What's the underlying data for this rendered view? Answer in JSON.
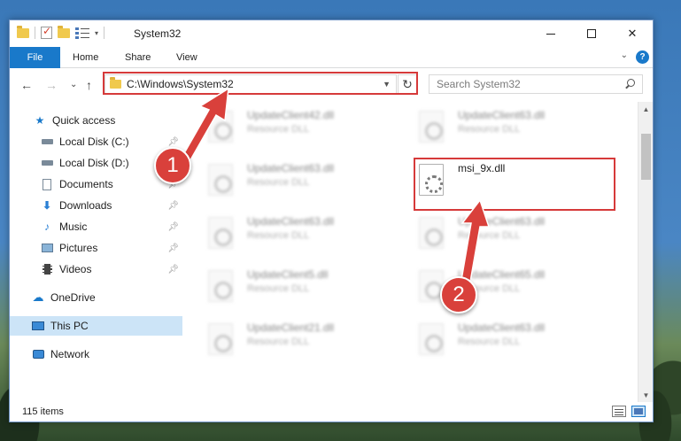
{
  "window": {
    "title": "System32",
    "controls": {
      "minimize": "",
      "maximize": "",
      "close": "✕"
    }
  },
  "ribbon": {
    "tabs": [
      {
        "label": "File"
      },
      {
        "label": "Home"
      },
      {
        "label": "Share"
      },
      {
        "label": "View"
      }
    ],
    "help": "?"
  },
  "navigation": {
    "back": "←",
    "forward": "→",
    "recent": "⌄",
    "up": "↑",
    "address": "C:\\Windows\\System32",
    "refresh": "↻"
  },
  "search": {
    "placeholder": "Search System32"
  },
  "sidebar": {
    "items": [
      {
        "label": "Quick access",
        "icon": "star-icon",
        "pinned": false
      },
      {
        "label": "Local Disk (C:)",
        "icon": "drive-icon",
        "pinned": true
      },
      {
        "label": "Local Disk (D:)",
        "icon": "drive-icon",
        "pinned": false
      },
      {
        "label": "Documents",
        "icon": "documents-icon",
        "pinned": true
      },
      {
        "label": "Downloads",
        "icon": "downloads-icon",
        "pinned": true
      },
      {
        "label": "Music",
        "icon": "music-icon",
        "pinned": true
      },
      {
        "label": "Pictures",
        "icon": "pictures-icon",
        "pinned": true
      },
      {
        "label": "Videos",
        "icon": "videos-icon",
        "pinned": true
      },
      {
        "label": "OneDrive",
        "icon": "cloud-icon",
        "pinned": false
      },
      {
        "label": "This PC",
        "icon": "computer-icon",
        "pinned": false,
        "selected": true
      },
      {
        "label": "Network",
        "icon": "network-icon",
        "pinned": false
      }
    ]
  },
  "files": [
    {
      "name": "UpdateClient42.dll",
      "type": "Resource DLL"
    },
    {
      "name": "UpdateClient63.dll",
      "type": "Resource DLL"
    },
    {
      "name": "UpdateClient63.dll",
      "type": "Resource DLL"
    },
    {
      "name": "msi_9x.dll",
      "type": ""
    },
    {
      "name": "UpdateClient63.dll",
      "type": "Resource DLL"
    },
    {
      "name": "UpdateClient63.dll",
      "type": "Resource DLL"
    },
    {
      "name": "UpdateClient5.dll",
      "type": "Resource DLL"
    },
    {
      "name": "UpdateClient65.dll",
      "type": "Resource DLL"
    },
    {
      "name": "UpdateClient21.dll",
      "type": "Resource DLL"
    },
    {
      "name": "UpdateClient63.dll",
      "type": "Resource DLL"
    }
  ],
  "status": {
    "item_count": "115 items"
  },
  "callouts": {
    "one": "1",
    "two": "2"
  },
  "colors": {
    "accent": "#1979ca",
    "highlight": "#d63a3a",
    "selected": "#cce4f7"
  }
}
